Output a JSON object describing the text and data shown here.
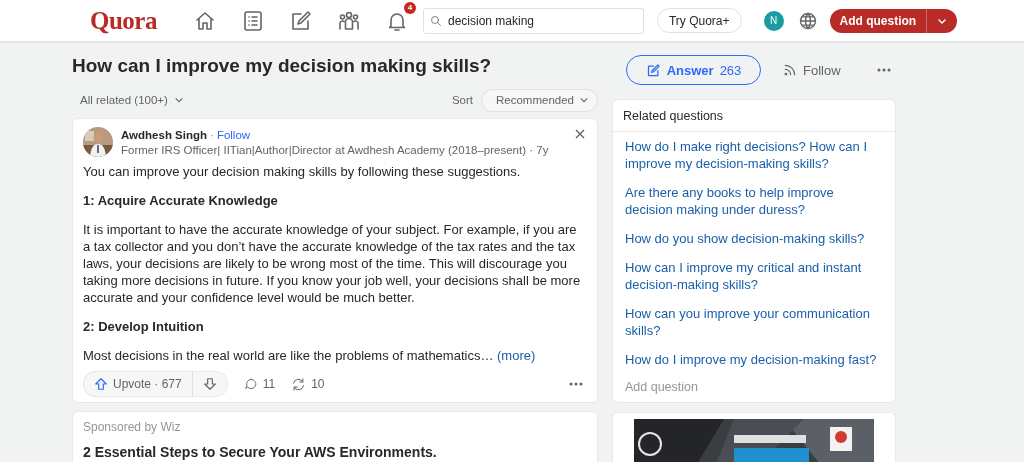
{
  "header": {
    "logo": "Quora",
    "nav": [
      {
        "kind": "home",
        "selected": false
      },
      {
        "kind": "answers",
        "selected": false
      },
      {
        "kind": "edit",
        "selected": false
      },
      {
        "kind": "spaces",
        "selected": false
      },
      {
        "kind": "notifications",
        "selected": false,
        "badge": "4"
      }
    ],
    "search": {
      "value": "decision making"
    },
    "try_button": "Try Quora+",
    "avatar_letter": "N",
    "add_question": "Add question"
  },
  "question": {
    "title": "How can I improve my decision making skills?",
    "answer_label": "Answer",
    "answer_count": "263",
    "follow": "Follow"
  },
  "feed": {
    "filter": "All related (100+)",
    "sort_label": "Sort",
    "sort_value": "Recommended"
  },
  "answer": {
    "author": "Awdhesh Singh",
    "separator": "·",
    "follow": "Follow",
    "credential": "Former IRS Officer| IITian|Author|Director at Awdhesh Academy (2018–present) · 7y",
    "body": [
      {
        "kind": "paragraph",
        "text": "You can improve your decision making skills by following these suggestions."
      },
      {
        "kind": "heading",
        "text": "1: Acquire Accurate Knowledge"
      },
      {
        "kind": "paragraph",
        "text": "It is important to have the accurate knowledge of your subject. For example, if you are a tax collector and you don’t have the accurate knowledge of the tax rates and the tax laws, your decisions are likely to be wrong most of the time. This will discourage you taking more decisions in future. If you know your job well, your decisions shall be more accurate and your confidence level would be much better."
      },
      {
        "kind": "heading",
        "text": "2: Develop Intuition"
      },
      {
        "kind": "paragraph",
        "text": "Most decisions in the real world are like the problems of mathematics…",
        "more": "(more)"
      }
    ],
    "upvote": "Upvote · 677",
    "comments": "11",
    "shares": "10"
  },
  "sponsored": {
    "label": "Sponsored by Wiz",
    "title": "2 Essential Steps to Secure Your AWS Environments."
  },
  "related": {
    "title": "Related questions",
    "items": [
      "How do I make right decisions? How can I improve my decision-making skills?",
      "Are there any books to help improve decision making under duress?",
      "How do you show decision-making skills?",
      "How can I improve my critical and instant decision-making skills?",
      "How can you improve your communication skills?",
      "How do I improve my decision-making fast?"
    ],
    "add_question": "Add question"
  }
}
